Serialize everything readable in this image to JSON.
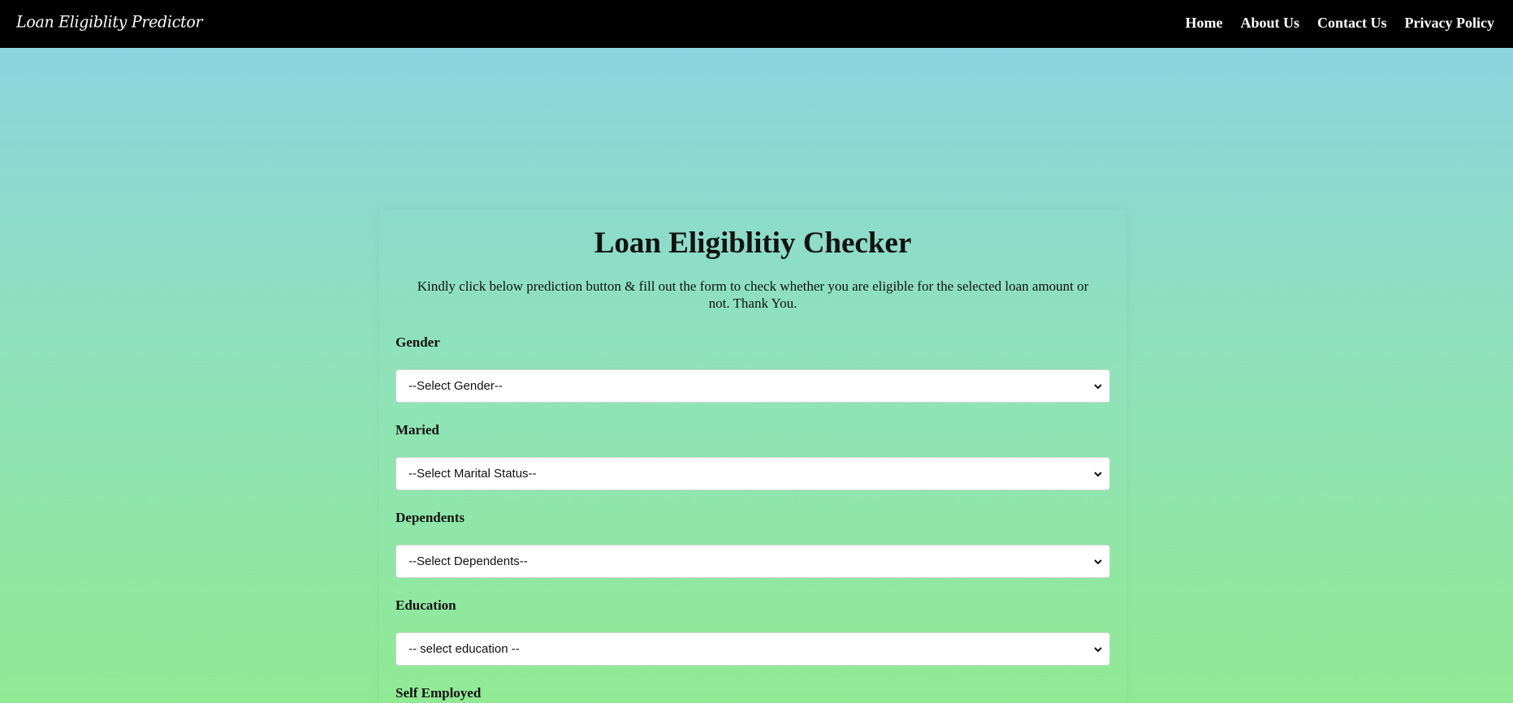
{
  "header": {
    "brand": "Loan Eligiblity Predictor",
    "nav": [
      {
        "label": "Home"
      },
      {
        "label": "About Us"
      },
      {
        "label": "Contact Us"
      },
      {
        "label": "Privacy Policy"
      }
    ]
  },
  "form": {
    "title": "Loan Eligiblitiy Checker",
    "description": "Kindly click below prediction button & fill out the form to check whether you are eligible for the selected loan amount or not. Thank You.",
    "fields": [
      {
        "label": "Gender",
        "selected": "--Select Gender--"
      },
      {
        "label": "Maried",
        "selected": "--Select Marital Status--"
      },
      {
        "label": "Dependents",
        "selected": "--Select Dependents--"
      },
      {
        "label": "Education",
        "selected": "-- select education --"
      },
      {
        "label": "Self Employed"
      }
    ]
  },
  "colors": {
    "navbar": "#000000",
    "gradient_top": "#89d2e3",
    "gradient_bottom": "#90ea94"
  },
  "icons": {
    "select_arrow": "chevron-down-icon"
  }
}
